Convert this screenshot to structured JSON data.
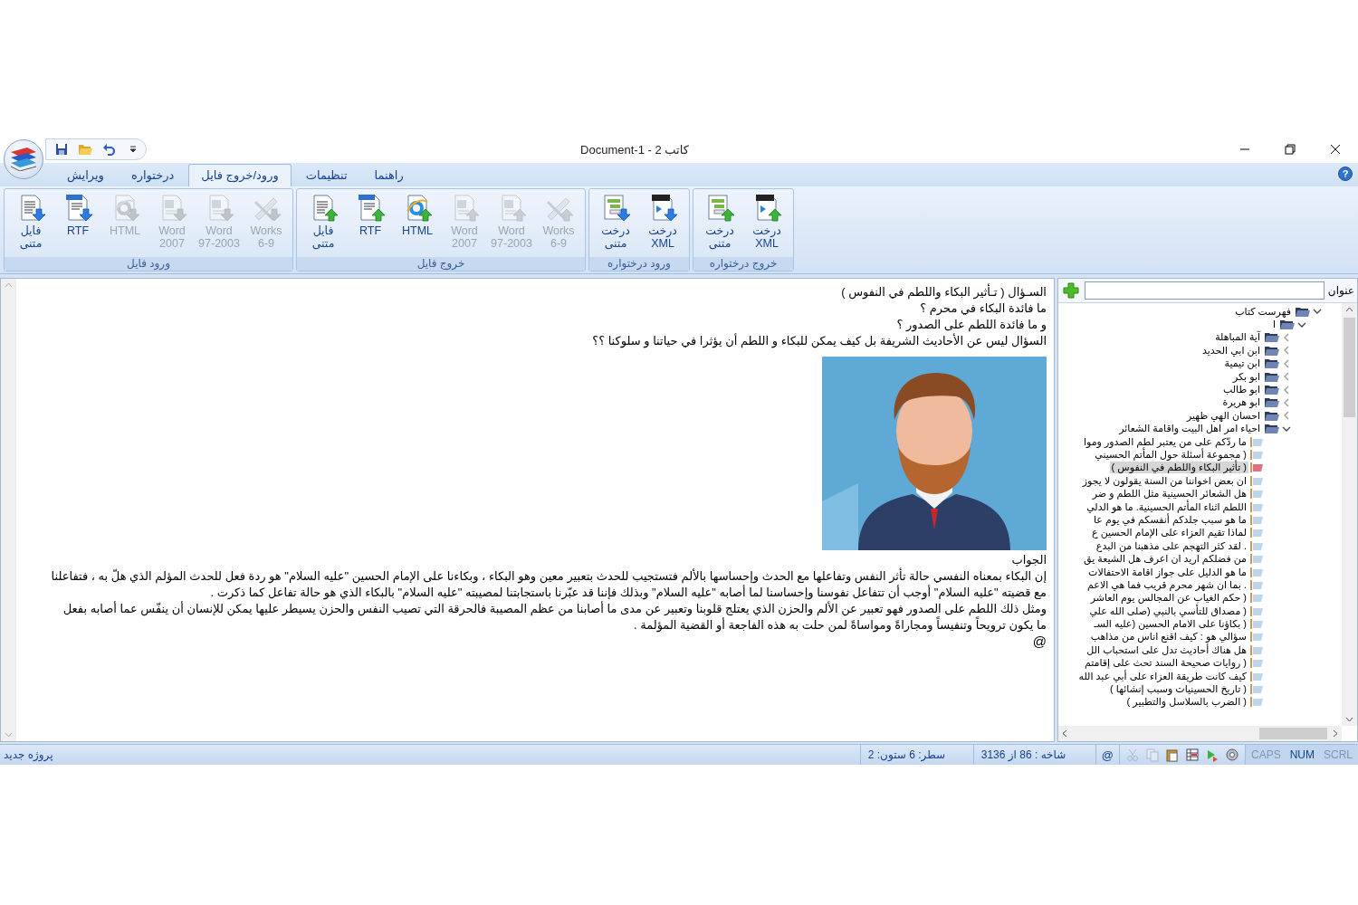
{
  "window": {
    "title": "Document-1 - کاتب 2",
    "help": "?"
  },
  "tabs": [
    {
      "label": "راهنما",
      "selected": false
    },
    {
      "label": "تنظیمات",
      "selected": false
    },
    {
      "label": "ورود/خروج فایل",
      "selected": true
    },
    {
      "label": "درختواره",
      "selected": false
    },
    {
      "label": "ویرایش",
      "selected": false
    }
  ],
  "ribbon_groups": [
    {
      "title": "خروج درختواره",
      "kind": "export",
      "buttons": [
        {
          "label": "درخت\nXML",
          "kind": "xml",
          "disabled": false
        },
        {
          "label": "درخت\nمتنی",
          "kind": "tree",
          "disabled": false
        }
      ]
    },
    {
      "title": "ورود درختواره",
      "kind": "import",
      "buttons": [
        {
          "label": "درخت\nXML",
          "kind": "xml",
          "disabled": false
        },
        {
          "label": "درخت\nمتنی",
          "kind": "tree",
          "disabled": false
        }
      ]
    },
    {
      "title": "خروج فایل",
      "kind": "export",
      "buttons": [
        {
          "label": "Works\n6-9",
          "kind": "works",
          "disabled": true
        },
        {
          "label": "Word\n97-2003",
          "kind": "word",
          "disabled": true
        },
        {
          "label": "Word\n2007",
          "kind": "word",
          "disabled": true
        },
        {
          "label": "HTML",
          "kind": "html",
          "disabled": false
        },
        {
          "label": "RTF",
          "kind": "rtf",
          "disabled": false
        },
        {
          "label": "فایل\nمتنی",
          "kind": "text",
          "disabled": false
        }
      ]
    },
    {
      "title": "ورود فایل",
      "kind": "import",
      "buttons": [
        {
          "label": "Works\n6-9",
          "kind": "works",
          "disabled": true
        },
        {
          "label": "Word\n97-2003",
          "kind": "word",
          "disabled": true
        },
        {
          "label": "Word\n2007",
          "kind": "word",
          "disabled": true
        },
        {
          "label": "HTML",
          "kind": "html",
          "disabled": true
        },
        {
          "label": "RTF",
          "kind": "rtf",
          "disabled": false
        },
        {
          "label": "فایل\nمتنی",
          "kind": "text",
          "disabled": false
        }
      ]
    }
  ],
  "document": {
    "lines": [
      "السـؤال ( تـأثير البكاء واللطم في النفوس )",
      "ما فائدة البكاء في محرم ؟",
      "و ما فائدة اللطم على الصدور ؟",
      "السؤال ليس عن الأحاديث الشريفة بل كيف يمكن للبكاء و اللطم أن يؤثرا في حياتنا و سلوكنا ؟؟"
    ],
    "image": {
      "kind": "picture"
    },
    "answer_heading": "الجواب",
    "paragraph_lines": [
      "إن البكاء بمعناه النفسي حالة تأثر النفس وتفاعلها مع الحدث وإحساسها بالألم فتستجيب للحدث بتعبير معين وهو البكاء ، وبكاءنا على الإمام الحسين \"عليه السلام\" هو ردة فعل للحدث المؤلم الذي هلّ به ، فتفاعلنا",
      "مع قضيته \"عليه السلام\" أوجب أن تتفاعل نفوسنا وإحساسنا لما أصابه \"عليه السلام\" وبذلك فإننا قد عبّرنا باستجابتنا لمصيبته \"عليه السلام\" بالبكاء الذي هو حالة تفاعل كما ذكرت .",
      " ومثل ذلك اللطم على الصدور فهو تعبير عن الألم والحزن الذي يعتلج قلوبنا وتعبير عن مدى ما أصابنا من عظم المصيبة فالحرقة التي تصيب النفس والحزن يسيطر عليها يمكن للإنسان أن ينفّس عما أصابه بفعل",
      "ما يكون ترويحاً وتنفيساً ومجاراةً ومواساةً لمن حلت به هذه الفاجعة أو القضية المؤلمة ."
    ],
    "end_mark": "@"
  },
  "tree_panel": {
    "search_label": "عنوان",
    "tree": [
      {
        "label": "فهرست کتاب",
        "kind": "folder",
        "expanded": true,
        "selected": false,
        "children": [
          {
            "label": "ا",
            "kind": "folder",
            "expanded": true,
            "selected": false,
            "children": [
              {
                "label": "آية المباهلة",
                "kind": "folder",
                "expanded": false,
                "selected": false
              },
              {
                "label": "ابن ابي الحديد",
                "kind": "folder",
                "expanded": false,
                "selected": false
              },
              {
                "label": "ابن تيمية",
                "kind": "folder",
                "expanded": false,
                "selected": false
              },
              {
                "label": "ابو بكر",
                "kind": "folder",
                "expanded": false,
                "selected": false
              },
              {
                "label": "ابو طالب",
                "kind": "folder",
                "expanded": false,
                "selected": false
              },
              {
                "label": "ابو هريرة",
                "kind": "folder",
                "expanded": false,
                "selected": false
              },
              {
                "label": "احسان الهي ظهير",
                "kind": "folder",
                "expanded": false,
                "selected": false
              },
              {
                "label": "احياء امر اهل البيت واقامة الشعائر",
                "kind": "folder",
                "expanded": true,
                "selected": false,
                "children": [
                  {
                    "label": "ما ردّكم على من يعتبر لطم الصدور وموا",
                    "kind": "document",
                    "selected": false
                  },
                  {
                    "label": "( مجموعة أسئلة حول المأتم الحسيني",
                    "kind": "document",
                    "selected": false
                  },
                  {
                    "label": "( تأثير البكاء واللطم في النفوس )",
                    "kind": "document",
                    "selected": true
                  },
                  {
                    "label": "ان بعض اخواننا من السنة يقولون لا يجوز",
                    "kind": "document",
                    "selected": false
                  },
                  {
                    "label": "هل الشعائر الحسينية مثل اللطم و ضر",
                    "kind": "document",
                    "selected": false
                  },
                  {
                    "label": "اللطم اثناء المأتم الحسينية. ما هو الدلي",
                    "kind": "document",
                    "selected": false
                  },
                  {
                    "label": "ما هو سبب جلدكم أنفسكم في يوم عا",
                    "kind": "document",
                    "selected": false
                  },
                  {
                    "label": "لماذا تقيم العزاء على الإمام الحسين ع",
                    "kind": "document",
                    "selected": false
                  },
                  {
                    "label": ". لقد كثر التهجم على مذهبنا من البدع",
                    "kind": "document",
                    "selected": false
                  },
                  {
                    "label": "من فضلكم اريد ان اعرف هل الشيعة يق",
                    "kind": "document",
                    "selected": false
                  },
                  {
                    "label": "ما هو الدليل على جواز اقامة الاحتفالات",
                    "kind": "document",
                    "selected": false
                  },
                  {
                    "label": ". بما ان شهر محرم قريب فما هي الاعم",
                    "kind": "document",
                    "selected": false
                  },
                  {
                    "label": "( حكم الغياب عن المجالس يوم العاشر",
                    "kind": "document",
                    "selected": false
                  },
                  {
                    "label": "( مصداق للتأسي بالنبي (صلى الله علي",
                    "kind": "document",
                    "selected": false
                  },
                  {
                    "label": "( بكاؤنا على الامام الحسين (عليه السـ",
                    "kind": "document",
                    "selected": false
                  },
                  {
                    "label": "سؤالي هو : كيف اقنع اناس من مذاهب",
                    "kind": "document",
                    "selected": false
                  },
                  {
                    "label": "هل هناك أحاديث تدل على استحباب الل",
                    "kind": "document",
                    "selected": false
                  },
                  {
                    "label": "( روايات صحيحة السند تحث على إقامتم",
                    "kind": "document",
                    "selected": false
                  },
                  {
                    "label": "كيف كانت طريقة العزاء على أبي عبد الله",
                    "kind": "document",
                    "selected": false
                  },
                  {
                    "label": "( تاريخ الحسينيات وسبب إنشائها )",
                    "kind": "document",
                    "selected": false
                  },
                  {
                    "label": "( الضرب بالسلاسل والتطبير )",
                    "kind": "document",
                    "selected": false
                  }
                ]
              }
            ]
          }
        ]
      }
    ]
  },
  "status_bar": {
    "project": "پروژه جدید",
    "position": "سطر: 6 ستون: 2",
    "branch": "شاخه : 86 از 3136",
    "mail_symbol": "@",
    "tools": [
      {
        "kind": "settings",
        "disabled": false
      },
      {
        "kind": "run",
        "disabled": false
      },
      {
        "kind": "table",
        "disabled": false
      },
      {
        "kind": "paste",
        "disabled": false
      },
      {
        "kind": "copy",
        "disabled": true
      },
      {
        "kind": "cut",
        "disabled": true
      }
    ],
    "indicators": [
      {
        "label": "SCRL",
        "on": false
      },
      {
        "label": "NUM",
        "on": true
      },
      {
        "label": "CAPS",
        "on": false
      }
    ]
  }
}
